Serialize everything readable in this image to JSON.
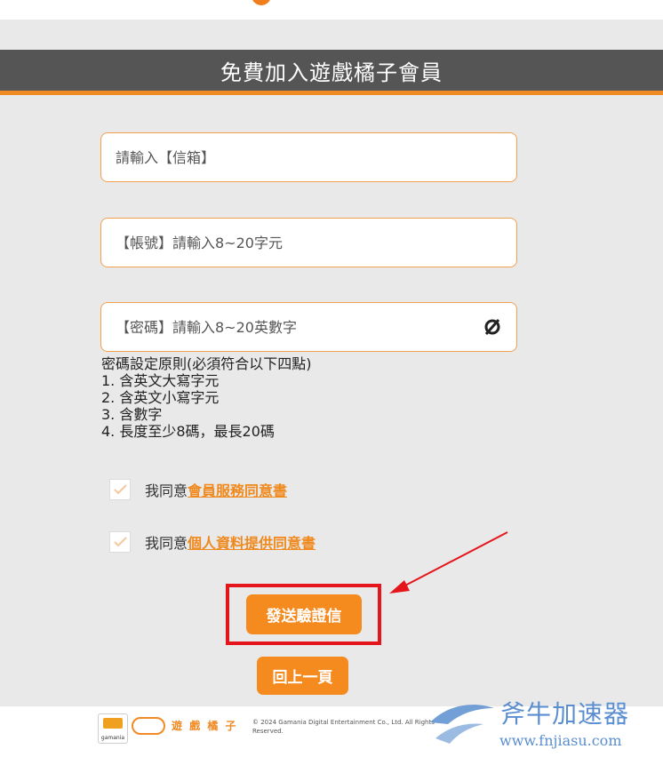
{
  "header": {
    "title": "免費加入遊戲橘子會員"
  },
  "form": {
    "email_placeholder": "請輸入【信箱】",
    "account_placeholder": "【帳號】請輸入8~20字元",
    "password_placeholder": "【密碼】請輸入8~20英數字",
    "password_toggle_icon": "eye-off-icon"
  },
  "password_rules": {
    "heading": "密碼設定原則(必須符合以下四點)",
    "items": [
      "1. 含英文大寫字元",
      "2. 含英文小寫字元",
      "3. 含數字",
      "4. 長度至少8碼，最長20碼"
    ]
  },
  "agreements": [
    {
      "prefix": "我同意",
      "link": "會員服務同意書"
    },
    {
      "prefix": "我同意",
      "link": "個人資料提供同意書"
    }
  ],
  "buttons": {
    "send": "發送驗證信",
    "back": "回上一頁"
  },
  "footer": {
    "gamania_logo_text": "gamania",
    "brand_text": "遊 戲 橘 子",
    "copyright": "© 2024 Gamania Digital Entertainment Co., Ltd. All Rights Reserved."
  },
  "watermark": {
    "title": "斧牛加速器",
    "url": "www.fnjiasu.com"
  },
  "colors": {
    "accent": "#f58a1f",
    "title_bar": "#555555",
    "annotation": "#e5151c",
    "watermark": "#5a8ed0"
  }
}
